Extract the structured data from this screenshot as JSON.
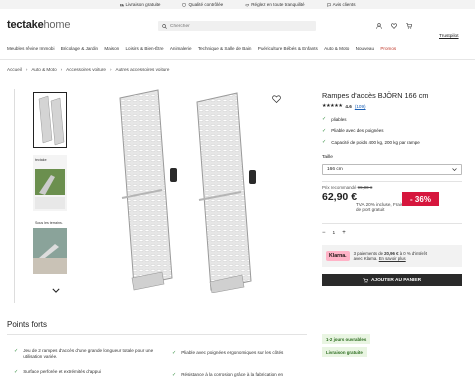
{
  "topbar": {
    "items": [
      {
        "label": "Livraison gratuite",
        "icon": "truck-icon"
      },
      {
        "label": "Qualité contrôlée",
        "icon": "shield-check-icon"
      },
      {
        "label": "Réglez en toute tranquilité",
        "icon": "handshake-icon"
      },
      {
        "label": "Avis clients",
        "icon": "chat-icon"
      }
    ]
  },
  "header": {
    "logo_main": "tectake",
    "logo_sub": "home",
    "search_placeholder": "Chercher",
    "account_label": "Trustpilot"
  },
  "nav": {
    "items": [
      "Meubles rêvine Immobi",
      "Bricolage & Jardin",
      "Maison",
      "Loisirs & Bien-Être",
      "Animalerie",
      "Technique & Salle de Bain",
      "Puériculture Bébés & Enfants",
      "Auto & Moto",
      "Nouveau",
      "Promos"
    ]
  },
  "breadcrumb": [
    "Accueil",
    "Auto & Moto",
    "Accessoires voiture",
    "Autres accessoires voiture"
  ],
  "product": {
    "title": "Rampes d'accès BJÖRN 166 cm",
    "stars": "★★★★★",
    "rating": "4.6",
    "review_count": "(109)",
    "features": [
      "pliables",
      "Pliable avec des poignées",
      "Capacité de poids 400 kg, 200 kg par rampe"
    ],
    "size_label": "Taille",
    "size_value": "166 cm",
    "rrp_label": "Prix recommandé",
    "rrp_value": "99,00 €",
    "price": "62,90 €",
    "tva": "TVA 20% incluse, Frais de port gratuit",
    "discount": "- 36%",
    "qty_minus": "−",
    "qty_value": "1",
    "qty_plus": "+",
    "klarna_badge": "Klarna.",
    "klarna_line1_a": "3 paiements de ",
    "klarna_line1_b": "20,96 €",
    "klarna_line1_c": " à 0 % d'intérêt",
    "klarna_line2_a": "avec Klarna. ",
    "klarna_line2_b": "En savoir plus",
    "add_to_cart": "AJOUTER AU PANIER"
  },
  "points_forts": {
    "title": "Points forts",
    "left": [
      "Jeu de 2 rampes d'accès d'une grande longueur totale pour une utilisation variée.",
      "Surface perforée et extrémités d'appui"
    ],
    "right": [
      "Pliable avec poignées ergonomiques sur les côtés",
      "Résistance à la corrosion grâce à la fabrication en"
    ]
  },
  "chips": [
    "1-2 jours ouvrables",
    "Livraison gratuite"
  ],
  "thumb_labels": [
    "",
    "tectake",
    "Sous les terrains."
  ],
  "colors": {
    "discount": "#d6163d",
    "check": "#2e8b3a",
    "klarna": "#ffb3c7"
  }
}
